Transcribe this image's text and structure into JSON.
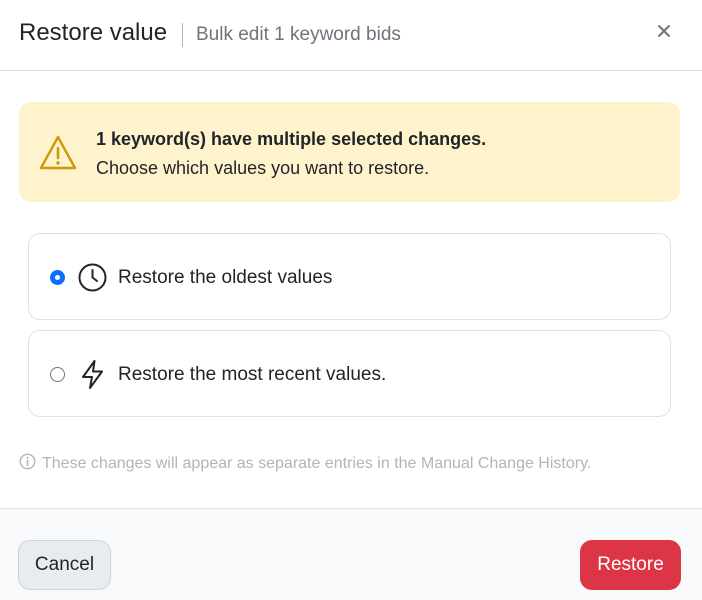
{
  "header": {
    "title": "Restore value",
    "subtitle": "Bulk edit 1 keyword bids",
    "close_icon": "close-icon"
  },
  "alert": {
    "icon": "warning-triangle-icon",
    "title": "1 keyword(s) have multiple selected changes.",
    "text": "Choose which values you want to restore.",
    "background": "#fff3cd"
  },
  "options": [
    {
      "label": "Restore the oldest values",
      "icon": "clock-icon",
      "selected": true
    },
    {
      "label": "Restore the most recent values.",
      "icon": "lightning-icon",
      "selected": false
    }
  ],
  "info": {
    "icon": "info-circle-icon",
    "text": "These changes will appear as separate entries in the Manual Change History."
  },
  "footer": {
    "cancel_label": "Cancel",
    "restore_label": "Restore",
    "restore_color": "#dc3545",
    "accent_color": "#0d6efd"
  }
}
